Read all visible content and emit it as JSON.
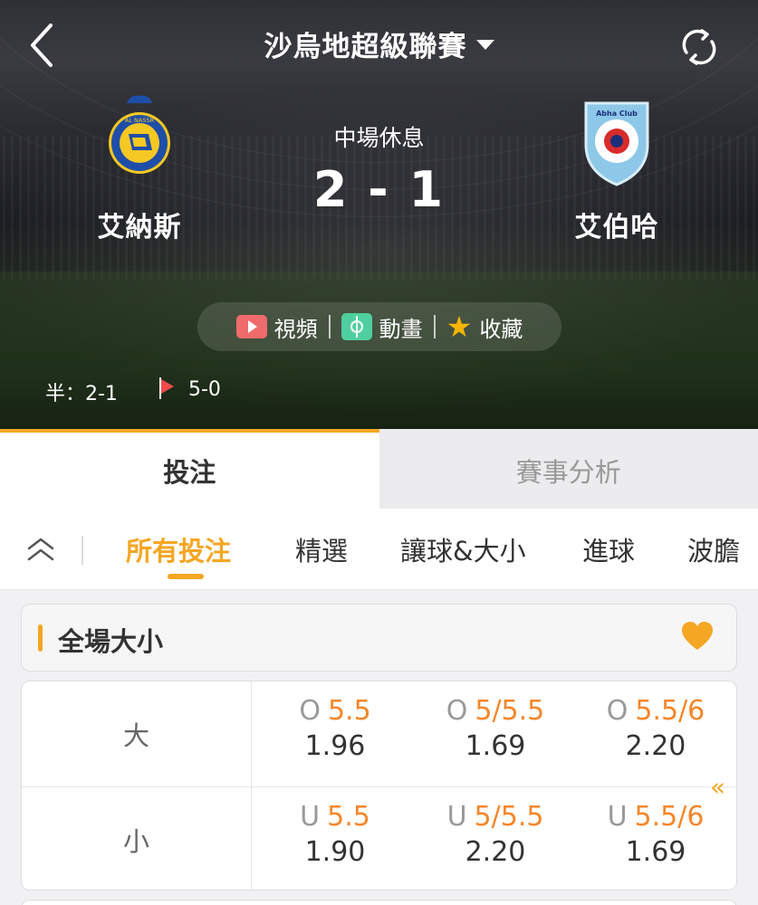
{
  "header": {
    "league": "沙烏地超級聯賽"
  },
  "match": {
    "home_team": "艾納斯",
    "away_team": "艾伯哈",
    "status": "中場休息",
    "score": "2 - 1",
    "home_crest_text": "AL NASSR",
    "away_crest_text": "Abha Club"
  },
  "media": {
    "video_label": "視頻",
    "animation_label": "動畫",
    "favorite_label": "收藏"
  },
  "stats": {
    "half_time": "半：2-1",
    "corners": "5-0"
  },
  "main_tabs": [
    {
      "label": "投注"
    },
    {
      "label": "賽事分析"
    }
  ],
  "sub_tabs": [
    {
      "label": "所有投注"
    },
    {
      "label": "精選"
    },
    {
      "label": "讓球&大小"
    },
    {
      "label": "進球"
    },
    {
      "label": "波膽"
    }
  ],
  "market": {
    "title": "全場大小",
    "rows": [
      {
        "label": "大",
        "cells": [
          {
            "prefix": "O",
            "line": "5.5",
            "odds": "1.96"
          },
          {
            "prefix": "O",
            "line": "5/5.5",
            "odds": "1.69"
          },
          {
            "prefix": "O",
            "line": "5.5/6",
            "odds": "2.20"
          }
        ]
      },
      {
        "label": "小",
        "cells": [
          {
            "prefix": "U",
            "line": "5.5",
            "odds": "1.90"
          },
          {
            "prefix": "U",
            "line": "5/5.5",
            "odds": "2.20"
          },
          {
            "prefix": "U",
            "line": "5.5/6",
            "odds": "1.69"
          }
        ]
      }
    ],
    "scroll_hint": "«"
  },
  "colors": {
    "accent": "#f5a623",
    "handicap": "#f5862a",
    "video": "#f06b6b",
    "animation": "#4fcfa0"
  },
  "icons": [
    "back-icon",
    "dropdown-caret-icon",
    "refresh-icon",
    "video-icon",
    "animation-icon",
    "star-icon",
    "corner-flag-icon",
    "collapse-up-icon",
    "heart-icon"
  ]
}
